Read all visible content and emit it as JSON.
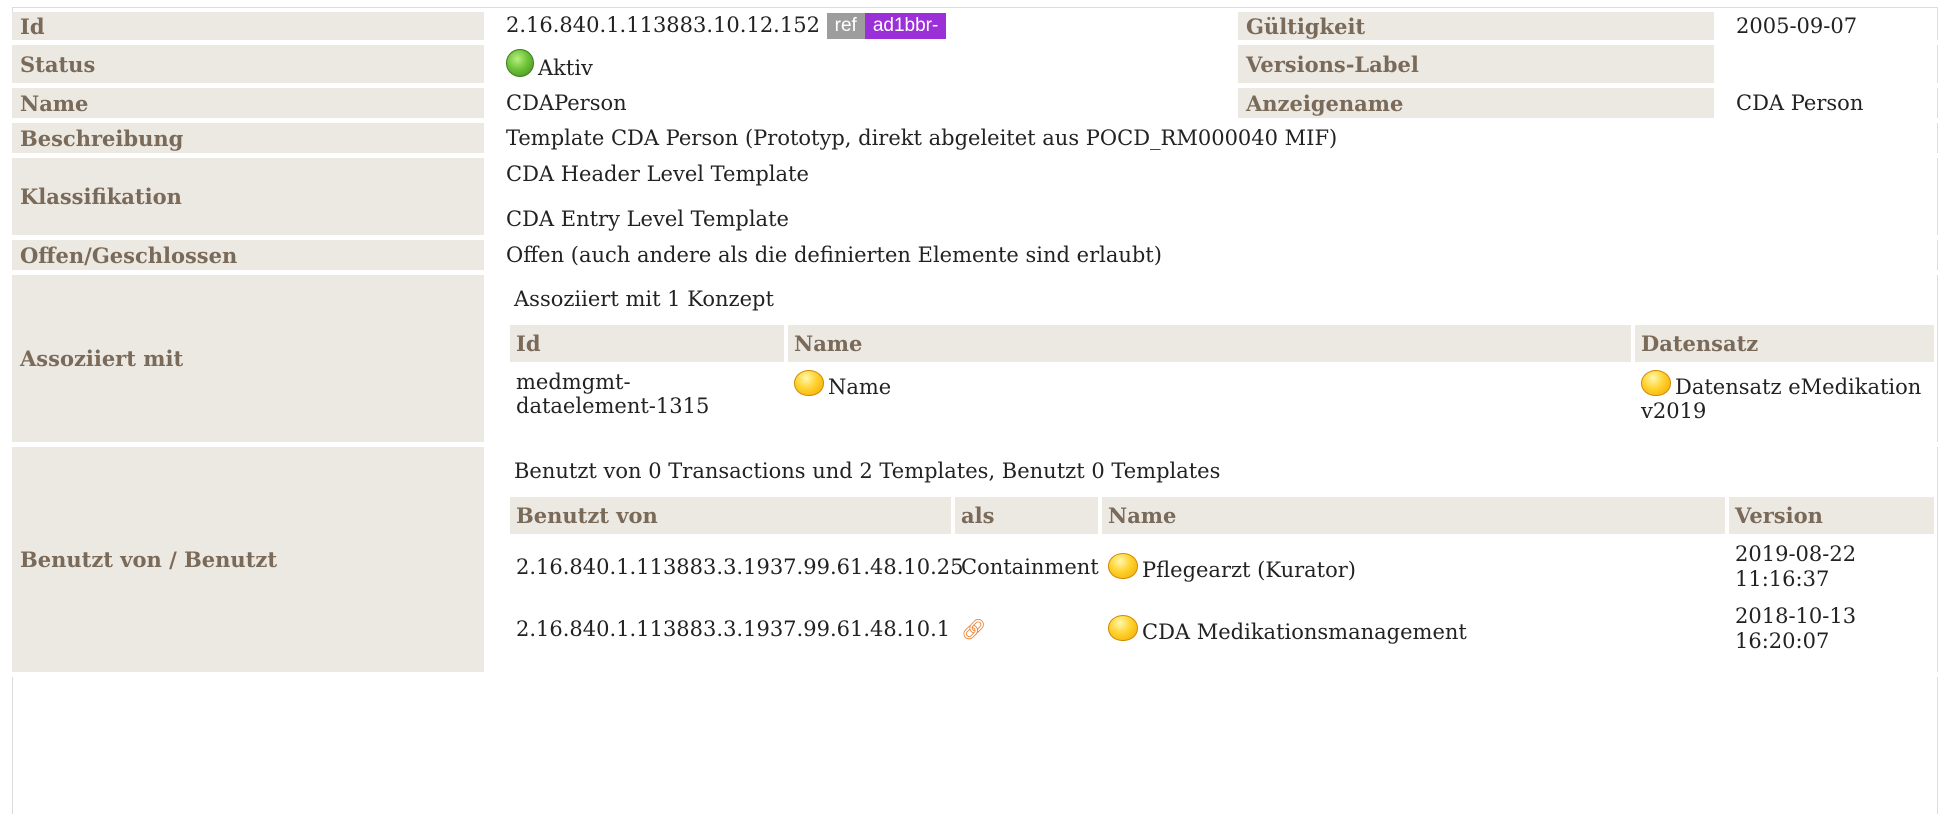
{
  "rows": {
    "id": {
      "label": "Id",
      "value": "2.16.840.1.113883.10.12.152",
      "ref_tag": "ref",
      "id_tag": "ad1bbr-"
    },
    "validity": {
      "label": "Gültigkeit",
      "value": "2005-09-07"
    },
    "status": {
      "label": "Status",
      "value": "Aktiv",
      "status_icon": "green-dot-icon"
    },
    "version_label": {
      "label": "Versions-Label",
      "value": ""
    },
    "name": {
      "label": "Name",
      "value": "CDAPerson"
    },
    "display_name": {
      "label": "Anzeigename",
      "value": "CDA Person"
    },
    "description": {
      "label": "Beschreibung",
      "value": "Template CDA Person (Prototyp, direkt abgeleitet aus POCD_RM000040 MIF)"
    },
    "classification": {
      "label": "Klassifikation",
      "values": [
        "CDA Header Level Template",
        "CDA Entry Level Template"
      ]
    },
    "open_closed": {
      "label": "Offen/Geschlossen",
      "value": "Offen (auch andere als die definierten Elemente sind erlaubt)"
    }
  },
  "associated": {
    "label": "Assoziiert mit",
    "intro": "Assoziiert mit 1 Konzept",
    "columns": [
      "Id",
      "Name",
      "Datensatz"
    ],
    "items": [
      {
        "id": "medmgmt-dataelement-1315",
        "name": "Name",
        "dataset": "Datensatz eMedikation v2019"
      }
    ]
  },
  "used_by": {
    "label": "Benutzt von / Benutzt",
    "intro": "Benutzt von 0 Transactions und 2 Templates, Benutzt 0 Templates",
    "columns": [
      "Benutzt von",
      "als",
      "Name",
      "Version"
    ],
    "items": [
      {
        "oid": "2.16.840.1.113883.3.1937.99.61.48.10.25",
        "as": "Containment",
        "name": "Pflegearzt (Kurator)",
        "version_date": "2019-08-22",
        "version_time": "11:16:37"
      },
      {
        "oid": "2.16.840.1.113883.3.1937.99.61.48.10.1",
        "as": "",
        "as_icon": "link-icon",
        "name": "CDA Medikationsmanagement",
        "version_date": "2018-10-13",
        "version_time": "16:20:07"
      }
    ]
  },
  "colors": {
    "label_bg": "#ece8e2",
    "label_text": "#7a6a59",
    "ref_tag": "#9d9d9d",
    "id_tag": "#9b2fd8",
    "status_active": "#6fc33a",
    "status_draft": "#ffd22e"
  }
}
